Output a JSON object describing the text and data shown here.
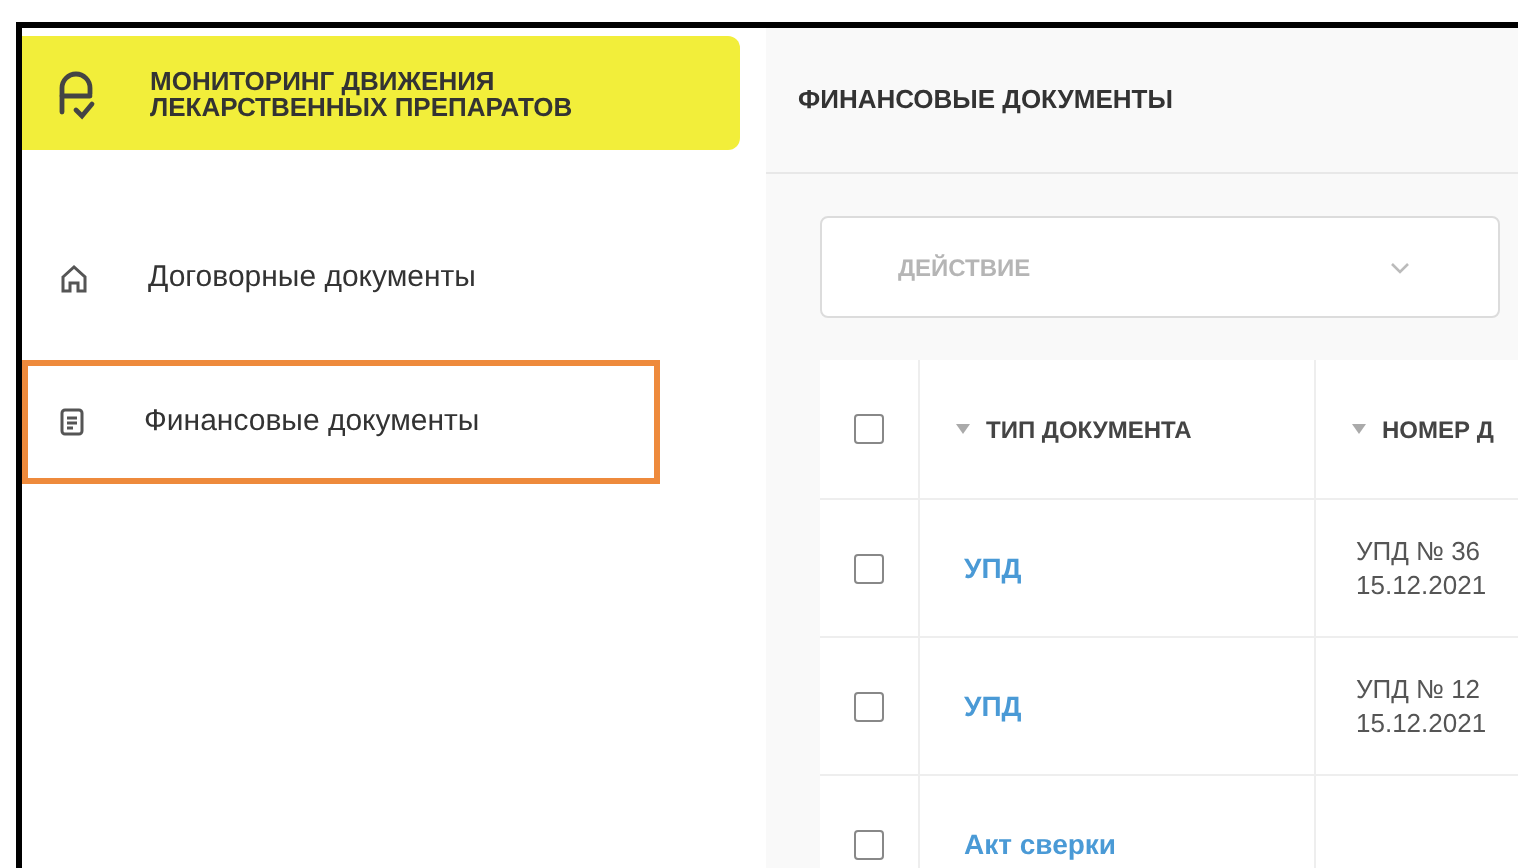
{
  "logo": {
    "title": "МОНИТОРИНГ ДВИЖЕНИЯ ЛЕКАРСТВЕННЫХ ПРЕПАРАТОВ"
  },
  "sidebar": {
    "items": [
      {
        "label": "Договорные документы",
        "kind": "home",
        "selected": false
      },
      {
        "label": "Финансовые документы",
        "kind": "document",
        "selected": true
      }
    ]
  },
  "header": {
    "title": "ФИНАНСОВЫЕ ДОКУМЕНТЫ"
  },
  "action_select": {
    "placeholder": "ДЕЙСТВИЕ"
  },
  "table": {
    "select_all_checked": false,
    "columns": [
      "ТИП ДОКУМЕНТА",
      "НОМЕР Д"
    ],
    "rows": [
      {
        "checked": false,
        "type": "УПД",
        "number": [
          "УПД № 36",
          "15.12.2021"
        ]
      },
      {
        "checked": false,
        "type": "УПД",
        "number": [
          "УПД № 12",
          "15.12.2021"
        ]
      },
      {
        "checked": false,
        "type": "Акт сверки",
        "number": []
      }
    ]
  }
}
